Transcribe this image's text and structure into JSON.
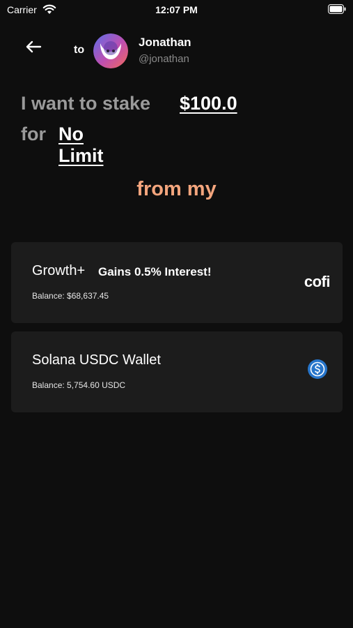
{
  "status_bar": {
    "carrier": "Carrier",
    "time": "12:07 PM"
  },
  "header": {
    "to_label": "to",
    "user_name": "Jonathan",
    "user_handle": "@jonathan"
  },
  "stake": {
    "prefix": "I want to stake",
    "amount": "$100.0",
    "for_label": "for",
    "duration": "No Limit"
  },
  "from_label": "from my",
  "accounts": [
    {
      "title": "Growth+",
      "tag": "Gains 0.5% Interest!",
      "balance": "Balance: $68,637.45",
      "logo_text": "cofi",
      "icon": "cofi-logo"
    },
    {
      "title": "Solana USDC Wallet",
      "balance": "Balance: 5,754.60 USDC",
      "icon": "usdc-icon"
    }
  ],
  "colors": {
    "background": "#0e0e0e",
    "card": "#1c1c1c",
    "accent": "#f3a57d",
    "usdc_blue": "#2775ca"
  }
}
